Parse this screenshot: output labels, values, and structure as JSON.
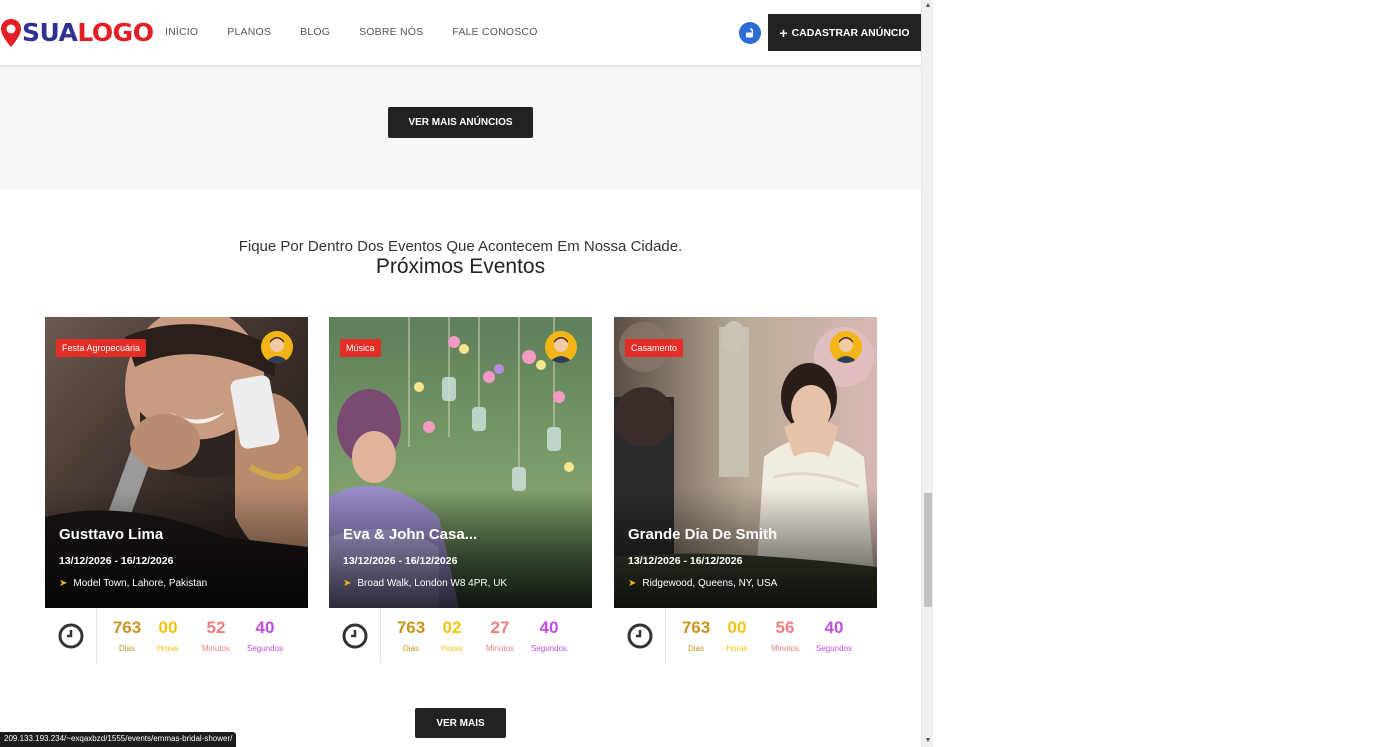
{
  "header": {
    "logo_part1": "SUA",
    "logo_part2": "LOGO",
    "nav": [
      "INÍCIO",
      "PLANOS",
      "BLOG",
      "SOBRE NÓS",
      "FALE CONOSCO"
    ],
    "cta_label": "CADASTRAR ANÚNCIO",
    "cta_icon": "+"
  },
  "listings_section": {
    "button_label": "VER MAIS ANÚNCIOS"
  },
  "events_section": {
    "subtitle": "Fique Por Dentro Dos Eventos Que Acontecem Em Nossa Cidade.",
    "title": "Próximos Eventos",
    "button_label": "VER MAIS",
    "labels": {
      "days": "Dias",
      "hours": "Horas",
      "minutes": "Minutos",
      "seconds": "Segundos"
    },
    "events": [
      {
        "category": "Festa Agropecuária",
        "title": "Gusttavo Lima",
        "dates": "13/12/2026 - 16/12/2026",
        "location": "Model Town, Lahore, Pakistan",
        "days": "763",
        "hours": "00",
        "minutes": "52",
        "seconds": "40"
      },
      {
        "category": "Música",
        "title": "Eva & John Casa...",
        "dates": "13/12/2026 - 16/12/2026",
        "location": "Broad Walk, London W8 4PR, UK",
        "days": "763",
        "hours": "02",
        "minutes": "27",
        "seconds": "40"
      },
      {
        "category": "Casamento",
        "title": "Grande Dia De Smith",
        "dates": "13/12/2026 - 16/12/2026",
        "location": "Ridgewood, Queens, NY, USA",
        "days": "763",
        "hours": "00",
        "minutes": "56",
        "seconds": "40"
      }
    ]
  },
  "status_bar": {
    "url": "209.133.193.234/~exqaxbzd/1555/events/emmas-bridal-shower/"
  },
  "colors": {
    "logo_blue": "#2e3192",
    "logo_red": "#e31e24",
    "badge_red": "#e52d27",
    "dias": "#c9941d",
    "horas": "#f2c311",
    "minutos": "#ef7f7f",
    "segundos": "#bf4fe0",
    "dark_button": "#222222",
    "lock_blue": "#2d6bd6"
  }
}
